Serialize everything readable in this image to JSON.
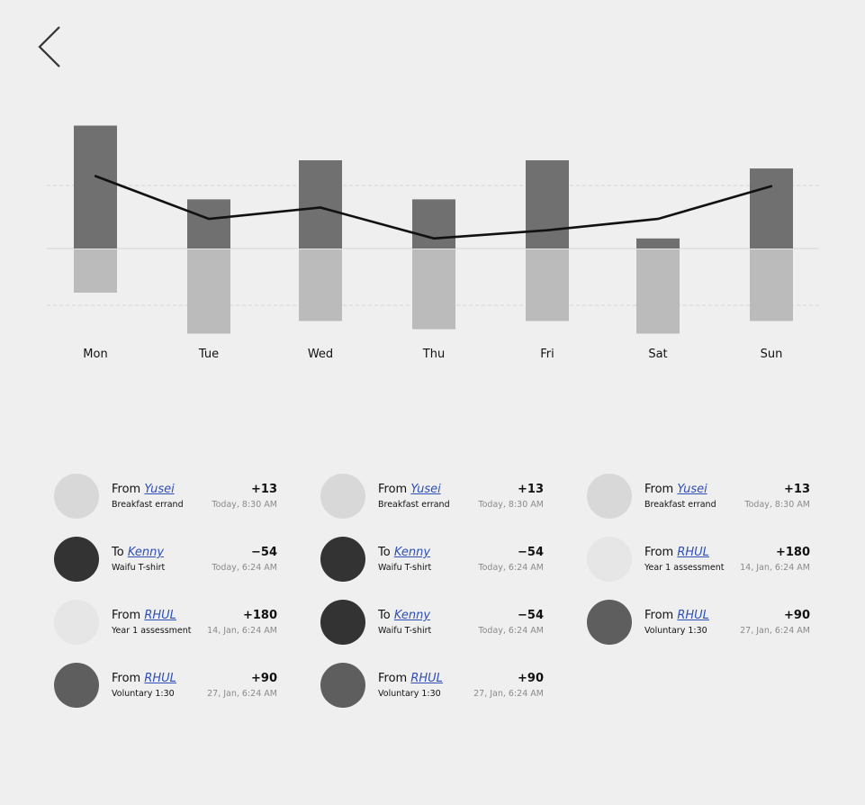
{
  "nav": {
    "back_icon": "chevron-left-icon"
  },
  "chart_data": {
    "type": "bar",
    "categories": [
      "Mon",
      "Tue",
      "Wed",
      "Thu",
      "Fri",
      "Sat",
      "Sun"
    ],
    "series": [
      {
        "values": [
          1.95,
          0.78,
          1.4,
          0.78,
          1.4,
          0.16,
          1.27
        ]
      },
      {
        "values": [
          -0.7,
          -1.35,
          -1.15,
          -1.28,
          -1.15,
          -1.35,
          -1.15
        ]
      },
      {
        "values": [
          1.15,
          0.47,
          0.65,
          0.16,
          0.29,
          0.47,
          0.99
        ]
      }
    ],
    "ylim": [
      -1.35,
      1.95
    ],
    "gridlines": [
      1.0,
      0,
      -0.9
    ],
    "legend": "none",
    "colors": {
      "positive": "#707070",
      "negative": "#bbbbbb",
      "line": "#111111",
      "grid": "#d6d6d6",
      "zero": "#dddddd"
    }
  },
  "transactions": {
    "columns": [
      [
        {
          "direction": "From",
          "name": "Yusei",
          "subtitle": "Breakfast errand",
          "amount": "+13",
          "time": "Today, 8:30 AM",
          "avatar_color": "#d8d8d8"
        },
        {
          "direction": "To",
          "name": "Kenny",
          "subtitle": "Waifu T-shirt",
          "amount": "−54",
          "time": "Today, 6:24 AM",
          "avatar_color": "#333333"
        },
        {
          "direction": "From",
          "name": "RHUL",
          "subtitle": "Year 1 assessment",
          "amount": "+180",
          "time": "14, Jan, 6:24 AM",
          "avatar_color": "#e6e6e6"
        },
        {
          "direction": "From",
          "name": "RHUL",
          "subtitle": "Voluntary 1:30",
          "amount": "+90",
          "time": "27, Jan, 6:24 AM",
          "avatar_color": "#5e5e5e"
        }
      ],
      [
        {
          "direction": "From",
          "name": "Yusei",
          "subtitle": "Breakfast errand",
          "amount": "+13",
          "time": "Today, 8:30 AM",
          "avatar_color": "#d8d8d8"
        },
        {
          "direction": "To",
          "name": "Kenny",
          "subtitle": "Waifu T-shirt",
          "amount": "−54",
          "time": "Today, 6:24 AM",
          "avatar_color": "#333333"
        },
        {
          "direction": "To",
          "name": "Kenny",
          "subtitle": "Waifu T-shirt",
          "amount": "−54",
          "time": "Today, 6:24 AM",
          "avatar_color": "#333333"
        },
        {
          "direction": "From",
          "name": "RHUL",
          "subtitle": "Voluntary 1:30",
          "amount": "+90",
          "time": "27, Jan, 6:24 AM",
          "avatar_color": "#5e5e5e"
        }
      ],
      [
        {
          "direction": "From",
          "name": "Yusei",
          "subtitle": "Breakfast errand",
          "amount": "+13",
          "time": "Today, 8:30 AM",
          "avatar_color": "#d8d8d8"
        },
        {
          "direction": "From",
          "name": "RHUL",
          "subtitle": "Year 1 assessment",
          "amount": "+180",
          "time": "14, Jan, 6:24 AM",
          "avatar_color": "#e6e6e6"
        },
        {
          "direction": "From",
          "name": "RHUL",
          "subtitle": "Voluntary 1:30",
          "amount": "+90",
          "time": "27, Jan, 6:24 AM",
          "avatar_color": "#5e5e5e"
        }
      ]
    ]
  }
}
